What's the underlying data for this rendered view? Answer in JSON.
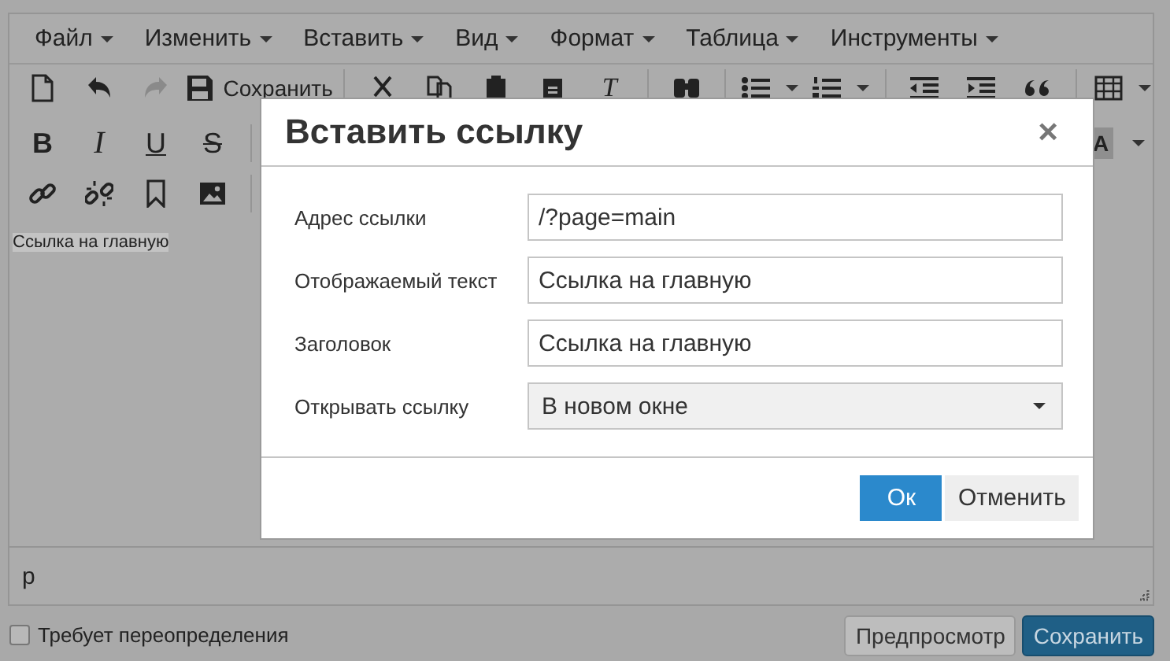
{
  "menubar": [
    {
      "label": "Файл"
    },
    {
      "label": "Изменить"
    },
    {
      "label": "Вставить"
    },
    {
      "label": "Вид"
    },
    {
      "label": "Формат"
    },
    {
      "label": "Таблица"
    },
    {
      "label": "Инструменты"
    }
  ],
  "toolbar": {
    "save_label": "Сохранить",
    "redo_disabled": true,
    "clear_format_glyph": "T",
    "format_glyphs": [
      "B",
      "I",
      "U",
      "S"
    ],
    "text_color_glyph": "A"
  },
  "content": {
    "selected_text": "Ссылка на главную"
  },
  "statusbar": {
    "path": "p"
  },
  "footer": {
    "override": {
      "label": "Требует переопределения",
      "checked": false
    },
    "preview_button": "Предпросмотр",
    "save_button": "Сохранить"
  },
  "dialog": {
    "title": "Вставить ссылку",
    "close": "×",
    "fields": [
      {
        "kind": "text",
        "label": "Адрес ссылки",
        "value": "/?page=main"
      },
      {
        "kind": "text",
        "label": "Отображаемый текст",
        "value": "Ссылка на главную"
      },
      {
        "kind": "text",
        "label": "Заголовок",
        "value": "Ссылка на главную"
      },
      {
        "kind": "select",
        "label": "Открывать ссылку",
        "value": "В новом окне"
      }
    ],
    "ok": "Ок",
    "cancel": "Отменить"
  }
}
